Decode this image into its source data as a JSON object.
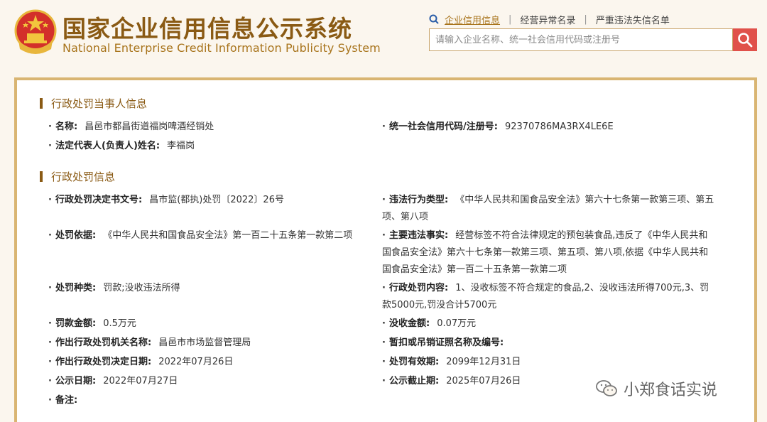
{
  "header": {
    "title_cn": "国家企业信用信息公示系统",
    "title_en": "National Enterprise Credit Information Publicity System",
    "nav": [
      {
        "label": "企业信用信息",
        "active": true
      },
      {
        "label": "经营异常名录",
        "active": false
      },
      {
        "label": "严重违法失信名单",
        "active": false
      }
    ],
    "search_placeholder": "请输入企业名称、统一社会信用代码或注册号",
    "icons": {
      "emblem": "national-emblem-icon",
      "nav": "search-small-icon",
      "search": "search-icon"
    },
    "colors": {
      "brand": "#8a5a14",
      "search_button": "#e0514a",
      "border": "#d9b572"
    }
  },
  "party_section": {
    "title": "行政处罚当事人信息",
    "name": {
      "label": "名称:",
      "value": "昌邑市都昌街道福岗啤酒经销处"
    },
    "credit_code": {
      "label": "统一社会信用代码/注册号:",
      "value": "92370786MA3RX4LE6E"
    },
    "legal_rep": {
      "label": "法定代表人(负责人)姓名:",
      "value": "李福岗"
    }
  },
  "penalty_section": {
    "title": "行政处罚信息",
    "doc_no": {
      "label": "行政处罚决定书文号:",
      "value": "昌市监(都执)处罚〔2022〕26号"
    },
    "violation_type": {
      "label": "违法行为类型:",
      "value": "《中华人民共和国食品安全法》第六十七条第一款第三项、第五项、第八项"
    },
    "basis": {
      "label": "处罚依据:",
      "value": "《中华人民共和国食品安全法》第一百二十五条第一款第二项"
    },
    "main_facts": {
      "label": "主要违法事实:",
      "value": "经营标签不符合法律规定的预包装食品,违反了《中华人民共和国食品安全法》第六十七条第一款第三项、第五项、第八项,依据《中华人民共和国食品安全法》第一百二十五条第一款第二项"
    },
    "penalty_kind": {
      "label": "处罚种类:",
      "value": "罚款;没收违法所得"
    },
    "penalty_content": {
      "label": "行政处罚内容:",
      "value": "1、没收标签不符合规定的食品,2、没收违法所得700元,3、罚款5000元,罚没合计5700元"
    },
    "fine_amount": {
      "label": "罚款金额:",
      "value": "0.5万元"
    },
    "confiscation_amount": {
      "label": "没收金额:",
      "value": "0.07万元"
    },
    "authority": {
      "label": "作出行政处罚机关名称:",
      "value": "昌邑市市场监督管理局"
    },
    "license_revoke": {
      "label": "暂扣或吊销证照名称及编号:",
      "value": ""
    },
    "decision_date": {
      "label": "作出行政处罚决定日期:",
      "value": "2022年07月26日"
    },
    "valid_until": {
      "label": "处罚有效期:",
      "value": "2099年12月31日"
    },
    "publish_date": {
      "label": "公示日期:",
      "value": "2022年07月27日"
    },
    "publish_end": {
      "label": "公示截止期:",
      "value": "2025年07月26日"
    },
    "remarks": {
      "label": "备注:",
      "value": ""
    }
  },
  "watermark": {
    "text": "小郑食话实说",
    "icon": "wechat-icon"
  }
}
